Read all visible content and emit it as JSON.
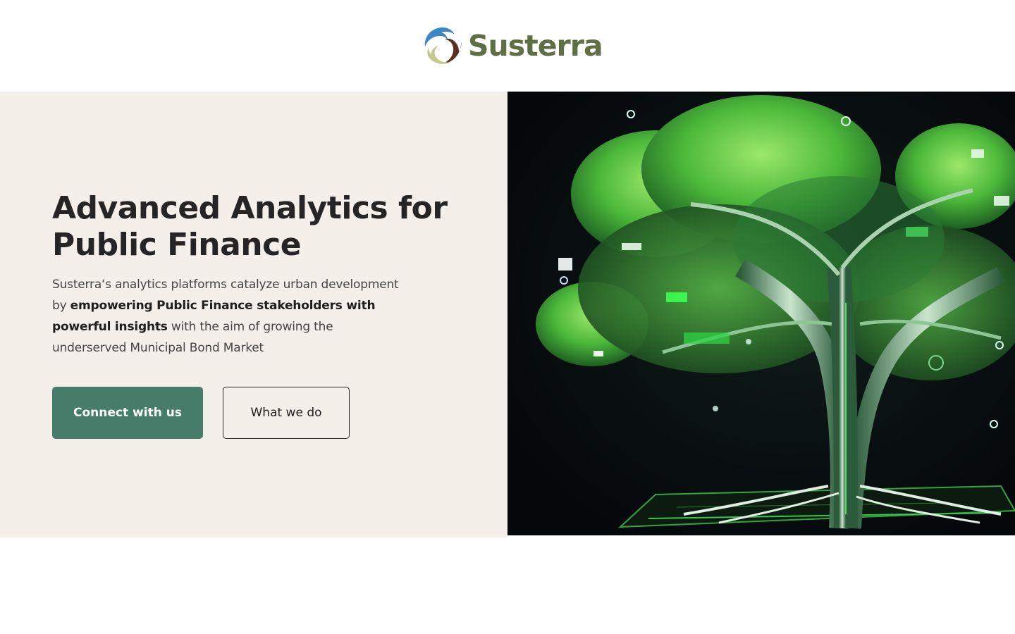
{
  "brand": {
    "name": "Susterra",
    "text_color": "#5f6f45"
  },
  "hero": {
    "title": "Advanced Analytics for Public Finance",
    "description": {
      "part1": "Susterra‘s analytics platforms catalyze urban development by ",
      "bold": "empowering Public Finance stakeholders with powerful insights",
      "part2": " with the aim of growing the underserved Municipal Bond Market"
    },
    "primary_button": "Connect with us",
    "secondary_button": "What we do",
    "background_color": "#f5efe9",
    "primary_color": "#467d6a",
    "image": "digital-circuit-tree-image"
  }
}
